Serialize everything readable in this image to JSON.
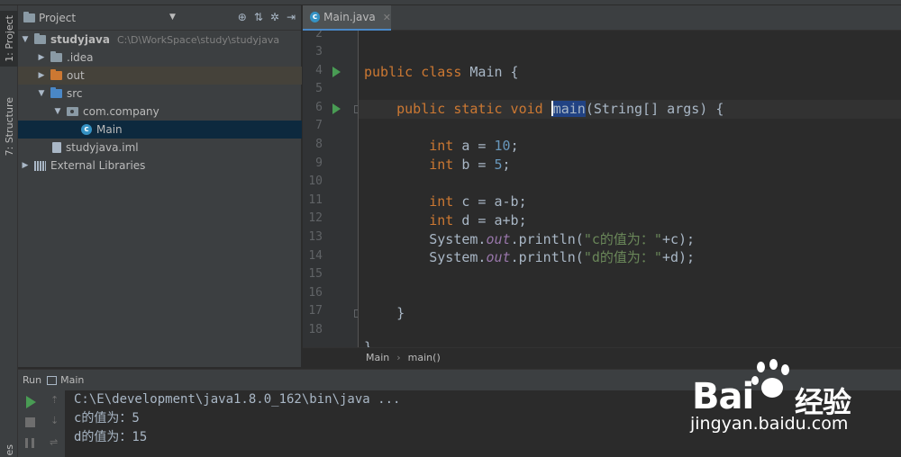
{
  "left_strip": {
    "project_tab": "1: Project",
    "structure_tab": "7: Structure",
    "bottom_tab": "es"
  },
  "project_panel": {
    "title": "Project",
    "tree": [
      {
        "label": "studyjava",
        "path": "C:\\D\\WorkSpace\\study\\studyjava",
        "icon": "module-folder-icon"
      },
      {
        "label": ".idea",
        "icon": "folder-icon"
      },
      {
        "label": "out",
        "icon": "folder-orange-icon"
      },
      {
        "label": "src",
        "icon": "source-folder-icon"
      },
      {
        "label": "com.company",
        "icon": "package-icon"
      },
      {
        "label": "Main",
        "icon": "java-class-icon"
      },
      {
        "label": "studyjava.iml",
        "icon": "iml-file-icon"
      },
      {
        "label": "External Libraries",
        "icon": "libraries-icon"
      }
    ]
  },
  "editor": {
    "tab": {
      "label": "Main.java",
      "icon": "java-class-icon"
    },
    "line_numbers": [
      "2",
      "3",
      "4",
      "5",
      "6",
      "7",
      "8",
      "9",
      "10",
      "11",
      "12",
      "13",
      "14",
      "15",
      "16",
      "17",
      "18"
    ],
    "code": {
      "l4": {
        "kw": "public class",
        "rest": " Main {"
      },
      "l6": {
        "kw": "public static void",
        "sel": "main",
        "rest": "(String[] args) {"
      },
      "l8": {
        "kw": "int",
        "mid": " a = ",
        "num": "10",
        "end": ";"
      },
      "l9": {
        "kw": "int",
        "mid": " b = ",
        "num": "5",
        "end": ";"
      },
      "l11": {
        "kw": "int",
        "rest": " c = a-b;"
      },
      "l12": {
        "kw": "int",
        "rest": " d = a+b;"
      },
      "l13": {
        "pre": "System.",
        "fld": "out",
        "mid": ".println(",
        "str": "\"c的值为：\"",
        "end": "+c);"
      },
      "l14": {
        "pre": "System.",
        "fld": "out",
        "mid": ".println(",
        "str": "\"d的值为：\"",
        "end": "+d);"
      },
      "l17": {
        "rest": "}"
      },
      "l19": {
        "rest": "}"
      }
    },
    "breadcrumb": [
      "Main",
      "main()"
    ]
  },
  "run_panel": {
    "title": "Run",
    "config": "Main",
    "console": [
      "C:\\E\\development\\java1.8.0_162\\bin\\java ...",
      "c的值为：5",
      "d的值为：15"
    ]
  },
  "watermark": {
    "logo_text": "Bai",
    "logo_suffix": "经验",
    "url": "jingyan.baidu.com"
  }
}
